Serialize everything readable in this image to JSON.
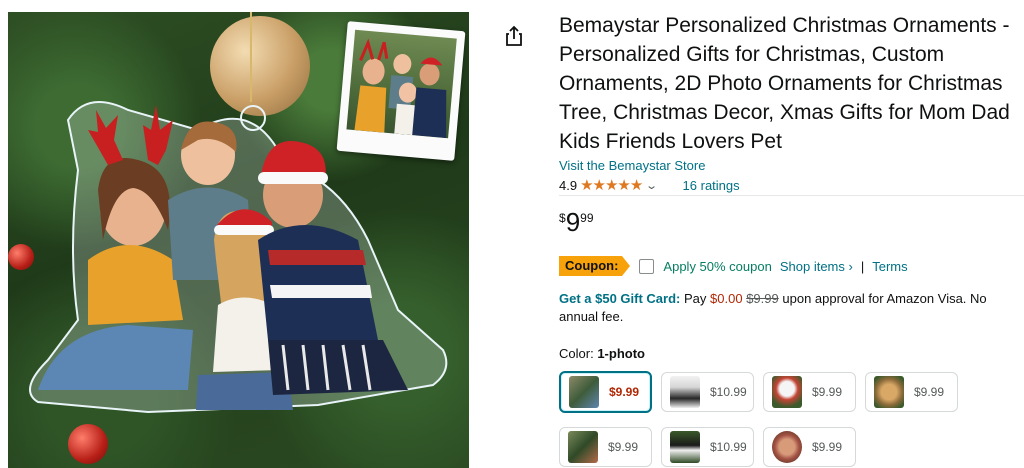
{
  "product": {
    "title": "Bemaystar Personalized Christmas Ornaments - Personalized Gifts for Christmas, Custom Ornaments, 2D Photo Ornaments for Christmas Tree, Christmas Decor, Xmas Gifts for Mom Dad Kids Friends Lovers Pet",
    "store_link": "Visit the Bemaystar Store",
    "rating": "4.9",
    "stars": "★★★★★",
    "ratings_count": "16 ratings",
    "price": {
      "symbol": "$",
      "whole": "9",
      "fraction": "99"
    },
    "coupon": {
      "badge": "Coupon:",
      "text": "Apply 50% coupon",
      "shop_items": "Shop items ›",
      "separator": "|",
      "terms": "Terms"
    },
    "gift_card": {
      "link": "Get a $50 Gift Card:",
      "pay_text": "Pay",
      "pay_amount": "$0.00",
      "original": "$9.99",
      "rest": "upon approval for Amazon Visa. No annual fee."
    },
    "color": {
      "label": "Color:",
      "selected": "1-photo"
    },
    "variants": [
      {
        "price": "$9.99",
        "selected": true
      },
      {
        "price": "$10.99",
        "selected": false
      },
      {
        "price": "$9.99",
        "selected": false
      },
      {
        "price": "$9.99",
        "selected": false
      },
      {
        "price": "$9.99",
        "selected": false
      },
      {
        "price": "$10.99",
        "selected": false
      },
      {
        "price": "$9.99",
        "selected": false
      }
    ]
  },
  "icons": {
    "share": "share-icon",
    "rating_dropdown": "chevron-down-icon"
  },
  "colors": {
    "link": "#007185",
    "star": "#de7921",
    "coupon_badge": "#f7a20b",
    "coupon_green": "#067d62",
    "price_red": "#b12704"
  }
}
